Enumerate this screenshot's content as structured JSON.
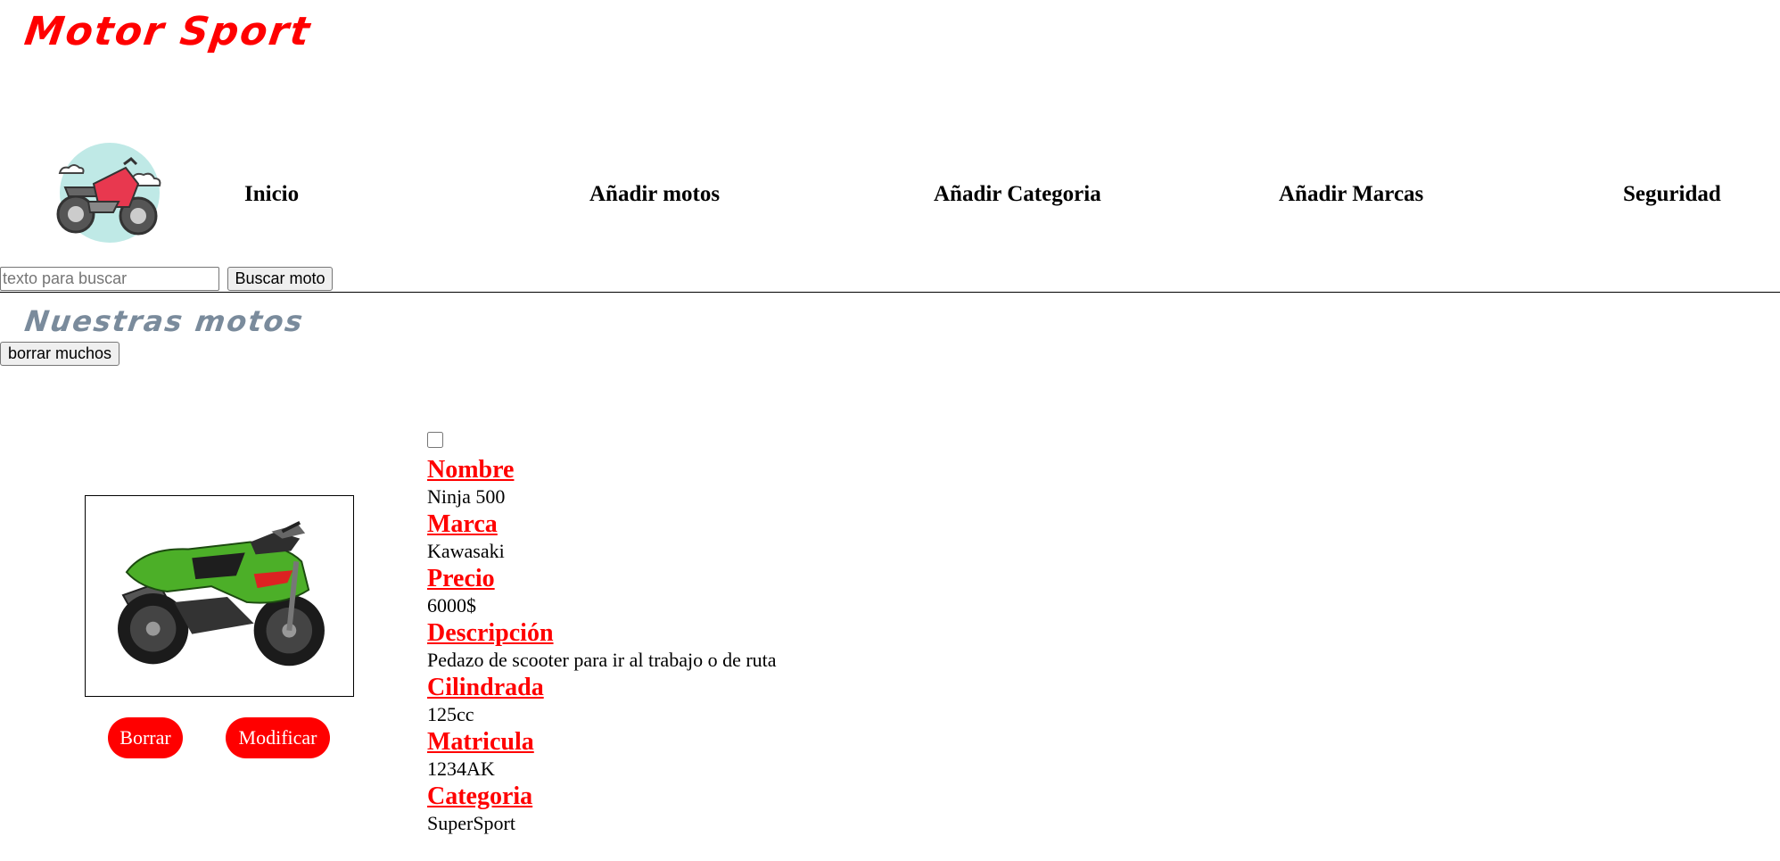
{
  "brand": {
    "title": "Motor Sport"
  },
  "nav": {
    "items": [
      {
        "label": "Inicio"
      },
      {
        "label": "Añadir motos"
      },
      {
        "label": "Añadir Categoria"
      },
      {
        "label": "Añadir Marcas"
      },
      {
        "label": "Seguridad"
      }
    ]
  },
  "search": {
    "placeholder": "texto para buscar",
    "value": "",
    "button_label": "Buscar moto"
  },
  "section": {
    "title": "Nuestras motos",
    "delete_many_label": "borrar muchos"
  },
  "moto": {
    "checked": false,
    "fields": [
      {
        "label": "Nombre",
        "value": "Ninja 500"
      },
      {
        "label": "Marca",
        "value": "Kawasaki"
      },
      {
        "label": "Precio",
        "value": "6000$"
      },
      {
        "label": "Descripción",
        "value": "Pedazo de scooter para ir al trabajo o de ruta"
      },
      {
        "label": "Cilindrada",
        "value": "125cc"
      },
      {
        "label": "Matricula",
        "value": "1234AK"
      },
      {
        "label": "Categoria",
        "value": "SuperSport"
      }
    ],
    "actions": {
      "delete_label": "Borrar",
      "edit_label": "Modificar"
    }
  },
  "colors": {
    "accent": "#ff0000",
    "section_title": "#7a8b9c",
    "moto_green": "#4caf28"
  },
  "icons": {
    "logo": "motorcycle-logo-icon",
    "photo": "motorcycle-photo"
  }
}
